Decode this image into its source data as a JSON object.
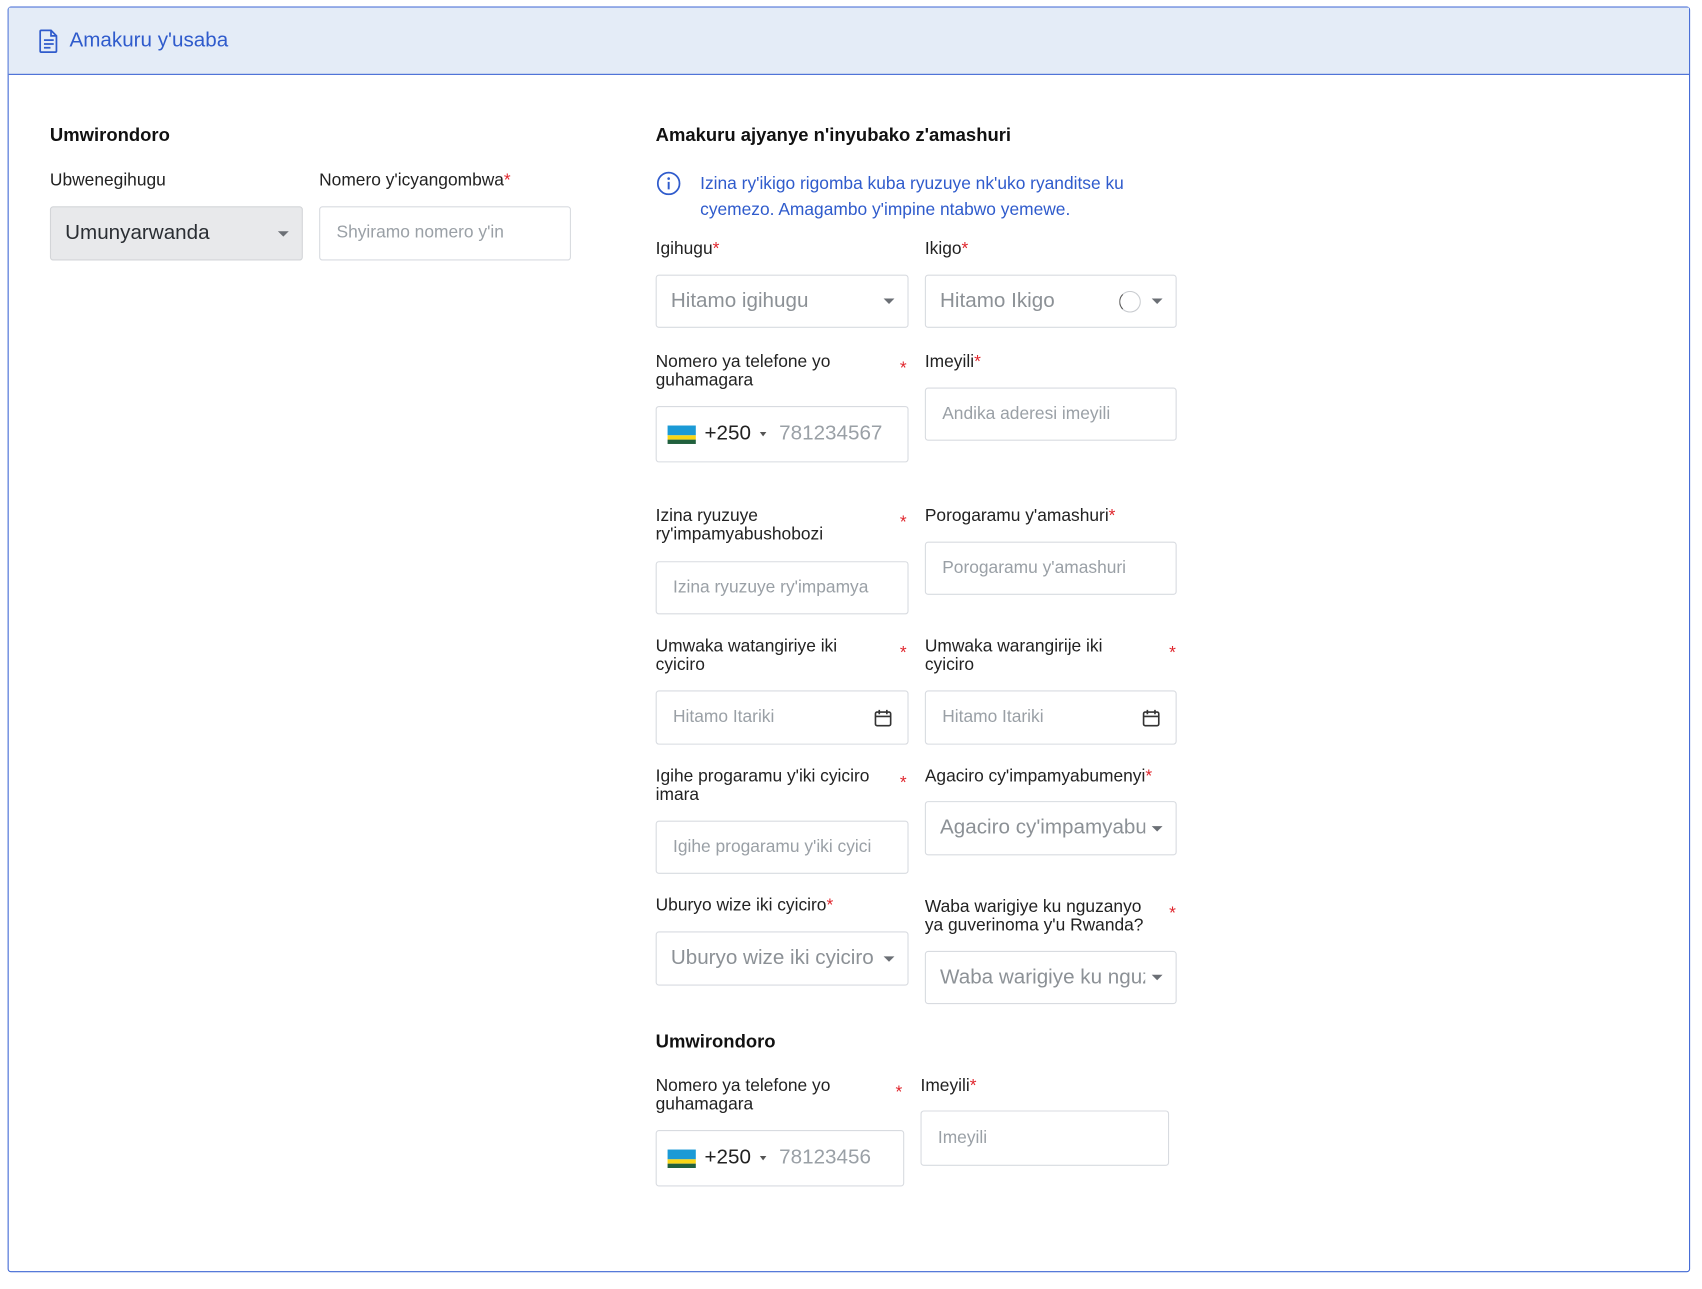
{
  "header": {
    "title": "Amakuru y'usaba",
    "icon": "document-icon"
  },
  "left": {
    "section_title": "Umwirondoro",
    "nationality_label": "Ubwenegihugu",
    "nationality_value": "Umunyarwanda",
    "id_label": "Nomero y'icyangombwa",
    "id_placeholder": "Shyiramo nomero y'in"
  },
  "education": {
    "section_title": "Amakuru ajyanye n'inyubako z'amashuri",
    "info_line1": "Izina ry'ikigo rigomba kuba ryuzuye nk'uko ryanditse ku",
    "info_line2": "cyemezo. Amagambo y'impine ntabwo yemewe.",
    "country_label": "Igihugu",
    "country_placeholder": "Hitamo igihugu",
    "school_label": "Ikigo",
    "school_placeholder": "Hitamo Ikigo",
    "phone_label_1": "Nomero ya telefone yo",
    "phone_label_2": "guhamagara",
    "phone_code": "+250",
    "phone_placeholder": "781234567",
    "email_label": "Imeyili",
    "email_placeholder": "Andika aderesi imeyili",
    "fullname_label_1": "Izina ryuzuye",
    "fullname_label_2": "ry'impamyabushobozi",
    "fullname_placeholder": "Izina ryuzuye ry'impamya",
    "program_label": "Porogaramu y'amashuri",
    "program_placeholder": "Porogaramu y'amashuri",
    "start_year_label_1": "Umwaka watangiriye iki",
    "start_year_label_2": "cyiciro",
    "start_year_placeholder": "Hitamo Itariki",
    "end_year_label_1": "Umwaka warangirije iki",
    "end_year_label_2": "cyiciro",
    "end_year_placeholder": "Hitamo Itariki",
    "duration_label_1": "Igihe progaramu y'iki cyiciro",
    "duration_label_2": "imara",
    "duration_placeholder": "Igihe progaramu y'iki cyici",
    "grade_label": "Agaciro cy'impamyabumenyi",
    "grade_placeholder": "Agaciro cy'impamyabumenyi",
    "mode_label": "Uburyo wize iki cyiciro",
    "mode_placeholder": "Uburyo wize iki cyiciro",
    "scholarship_label_1": "Waba warigiye ku nguzanyo",
    "scholarship_label_2": "ya guverinoma y'u Rwanda?",
    "scholarship_placeholder": "Waba warigiye ku nguzanyo"
  },
  "contact": {
    "section_title": "Umwirondoro",
    "phone_label_1": "Nomero ya telefone yo",
    "phone_label_2": "guhamagara",
    "phone_code": "+250",
    "phone_placeholder": "78123456",
    "email_label": "Imeyili",
    "email_placeholder": "Imeyili"
  },
  "required_marker": "*"
}
